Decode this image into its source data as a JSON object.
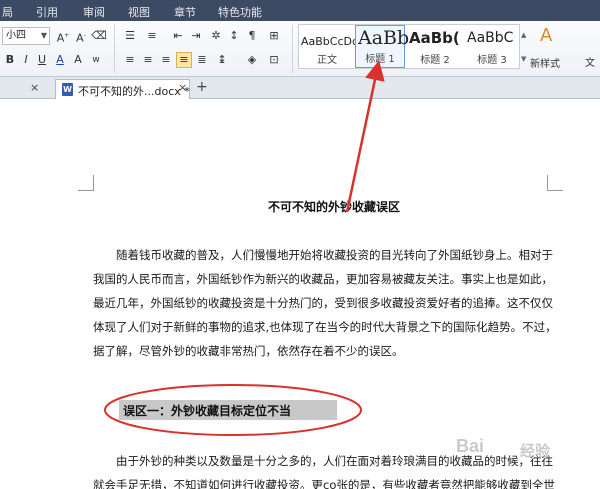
{
  "menu": {
    "items": [
      "局",
      "引用",
      "审阅",
      "视图",
      "章节",
      "特色功能"
    ]
  },
  "ribbon": {
    "font_size": "小四",
    "style_samples": [
      {
        "sample": "AaBbCcDc",
        "name": "正文"
      },
      {
        "sample": "AaBb",
        "name": "标题 1"
      },
      {
        "sample": "AaBb(",
        "name": "标题 2"
      },
      {
        "sample": "AaBbC",
        "name": "标题 3"
      }
    ],
    "new_style_label": "新样式",
    "edge_label": "文"
  },
  "tabs": {
    "doc_tab_label": "不可不知的外...docx *",
    "doc_icon_letter": "W",
    "close_glyph": "×",
    "new_tab_glyph": "+"
  },
  "document": {
    "title": "不可不知的外钞收藏误区",
    "paragraph1": [
      "随着钱币收藏的普及，人们慢慢地开始将收藏投资的目光转向了外国纸钞身上。相对于",
      "我国的人民币而言，外国纸钞作为新兴的收藏品，更加容易被藏友关注。事实上也是如此，",
      "最近几年，外国纸钞的收藏投资是十分热门的，受到很多收藏投资爱好者的追捧。这不仅仅",
      "体现了人们对于新鲜的事物的追求,也体现了在当今的时代大背景之下的国际化趋势。不过，",
      "据了解，尽管外钞的收藏非常热门，依然存在着不少的误区。"
    ],
    "heading": "误区一：外钞收藏目标定位不当",
    "paragraph2": [
      "由于外钞的种类以及数量是十分之多的，人们在面对着玲琅满目的收藏品的时候，往往",
      "就会手足无措，不知道如何进行收藏投资。更со张的是，有些收藏者竟然把能够收藏到全世"
    ]
  },
  "watermark": {
    "text": "Bai",
    "text2": "经验"
  },
  "colors": {
    "menubar": "#3d4a63",
    "annotation": "#d9312b",
    "highlight": "#c8c8c8"
  }
}
